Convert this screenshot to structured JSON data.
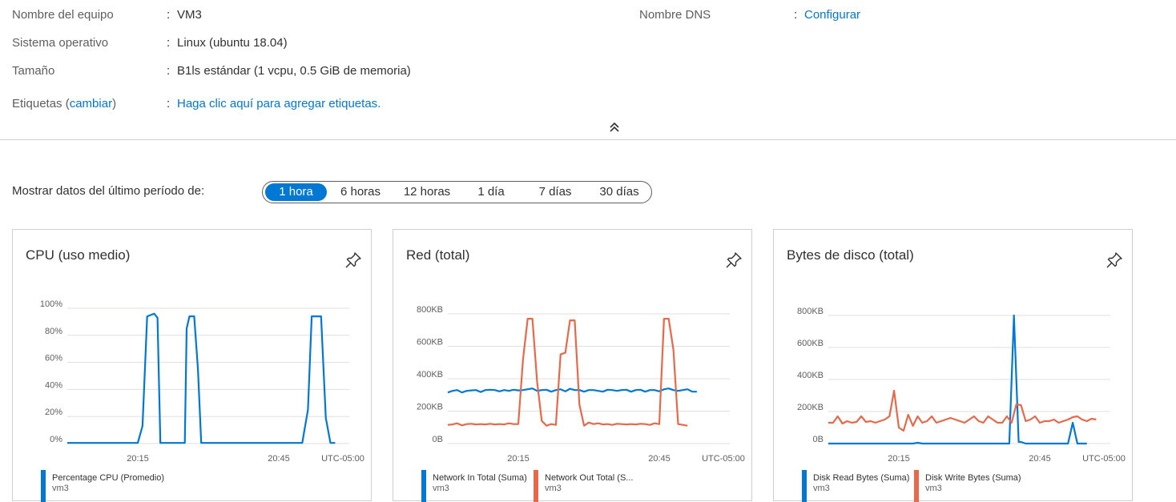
{
  "properties": [
    {
      "label": "Nombre del equipo",
      "colon": ":",
      "value": "VM3"
    },
    {
      "label": "Sistema operativo",
      "colon": ":",
      "value": "Linux (ubuntu 18.04)"
    },
    {
      "label": "Tamaño",
      "colon": ":",
      "value": "B1ls estándar (1 vcpu, 0.5 GiB de memoria)"
    }
  ],
  "tags": {
    "label_prefix": "Etiquetas (",
    "label_link": "cambiar",
    "label_suffix": ")",
    "colon": ":",
    "value_link": "Haga clic aquí para agregar etiquetas."
  },
  "dns": {
    "label": "Nombre DNS",
    "colon": ":",
    "value_link": "Configurar"
  },
  "collapse": {
    "icon": "chevron-double-up-icon"
  },
  "period": {
    "label": "Mostrar datos del último período de:",
    "options": [
      "1 hora",
      "6 horas",
      "12 horas",
      "1 día",
      "7 días",
      "30 días"
    ],
    "selected": "1 hora"
  },
  "colors": {
    "accent": "#0078d4",
    "series_blue": "#0078d4",
    "series_orange": "#e8684a",
    "grid": "#e1dfdd"
  },
  "charts": {
    "cpu": {
      "title": "CPU (uso medio)",
      "legend": [
        {
          "text": "Percentage CPU (Promedio)",
          "sub": "vm3",
          "color": "#0078d4"
        }
      ]
    },
    "net": {
      "title": "Red (total)",
      "legend": [
        {
          "text": "Network In Total (Suma)",
          "sub": "vm3",
          "color": "#0078d4"
        },
        {
          "text": "Network Out Total (S...",
          "sub": "vm3",
          "color": "#e8684a"
        }
      ]
    },
    "disk": {
      "title": "Bytes de disco (total)",
      "legend": [
        {
          "text": "Disk Read Bytes (Suma)",
          "sub": "vm3",
          "color": "#0078d4"
        },
        {
          "text": "Disk Write Bytes (Suma)",
          "sub": "vm3",
          "color": "#e8684a"
        }
      ]
    }
  },
  "chart_data": [
    {
      "type": "line",
      "title": "CPU (uso medio)",
      "x_ticks": [
        "20:15",
        "20:45",
        "UTC-05:00"
      ],
      "y_ticks": [
        "0%",
        "20%",
        "40%",
        "60%",
        "80%",
        "100%"
      ],
      "ylim": [
        0,
        100
      ],
      "x_minutes": [
        0,
        60
      ],
      "grid": true,
      "legend_placement": "bottom",
      "series": [
        {
          "name": "Percentage CPU (Promedio)",
          "color": "#0078d4",
          "points": [
            [
              0,
              0.5
            ],
            [
              1,
              0.5
            ],
            [
              2,
              0.5
            ],
            [
              4,
              0.5
            ],
            [
              6,
              0.5
            ],
            [
              8,
              0.5
            ],
            [
              10,
              0.5
            ],
            [
              12,
              0.5
            ],
            [
              14,
              0.5
            ],
            [
              15,
              0.5
            ],
            [
              16,
              13
            ],
            [
              17,
              94
            ],
            [
              18.5,
              96
            ],
            [
              19.2,
              93
            ],
            [
              19.8,
              0.5
            ],
            [
              21,
              0.5
            ],
            [
              23,
              0.5
            ],
            [
              25,
              0.5
            ],
            [
              25.4,
              85
            ],
            [
              26,
              94
            ],
            [
              27,
              94
            ],
            [
              27.8,
              55
            ],
            [
              28.5,
              0.5
            ],
            [
              30,
              0.5
            ],
            [
              34,
              0.5
            ],
            [
              38,
              0.5
            ],
            [
              42,
              0.5
            ],
            [
              46,
              0.5
            ],
            [
              50,
              0.5
            ],
            [
              51.2,
              25
            ],
            [
              52,
              94
            ],
            [
              54,
              94
            ],
            [
              55,
              19
            ],
            [
              56,
              0.5
            ],
            [
              57,
              0.5
            ]
          ]
        }
      ]
    },
    {
      "type": "line",
      "title": "Red (total)",
      "x_ticks": [
        "20:15",
        "20:45",
        "UTC-05:00"
      ],
      "y_ticks": [
        "0B",
        "200KB",
        "400KB",
        "600KB",
        "800KB"
      ],
      "ylim": [
        0,
        800
      ],
      "x_minutes": [
        0,
        60
      ],
      "grid": true,
      "legend_placement": "bottom",
      "series": [
        {
          "name": "Network In Total (Suma)",
          "color": "#0078d4",
          "points": [
            [
              0,
              315
            ],
            [
              1,
              325
            ],
            [
              2,
              330
            ],
            [
              3,
              315
            ],
            [
              4,
              325
            ],
            [
              5,
              328
            ],
            [
              6,
              330
            ],
            [
              7,
              318
            ],
            [
              8,
              330
            ],
            [
              9,
              332
            ],
            [
              10,
              330
            ],
            [
              11,
              322
            ],
            [
              12,
              330
            ],
            [
              13,
              325
            ],
            [
              14,
              332
            ],
            [
              15,
              328
            ],
            [
              16,
              330
            ],
            [
              17,
              335
            ],
            [
              18,
              340
            ],
            [
              19,
              325
            ],
            [
              20,
              330
            ],
            [
              21,
              332
            ],
            [
              22,
              320
            ],
            [
              23,
              330
            ],
            [
              24,
              335
            ],
            [
              25,
              322
            ],
            [
              26,
              338
            ],
            [
              27,
              330
            ],
            [
              28,
              330
            ],
            [
              29,
              320
            ],
            [
              30,
              330
            ],
            [
              31,
              330
            ],
            [
              32,
              325
            ],
            [
              33,
              320
            ],
            [
              34,
              332
            ],
            [
              35,
              330
            ],
            [
              36,
              325
            ],
            [
              37,
              330
            ],
            [
              38,
              332
            ],
            [
              39,
              320
            ],
            [
              40,
              330
            ],
            [
              41,
              332
            ],
            [
              42,
              320
            ],
            [
              43,
              330
            ],
            [
              44,
              330
            ],
            [
              45,
              322
            ],
            [
              46,
              335
            ],
            [
              47,
              340
            ],
            [
              48,
              330
            ],
            [
              49,
              325
            ],
            [
              50,
              330
            ],
            [
              51,
              335
            ],
            [
              52,
              320
            ],
            [
              53,
              320
            ]
          ]
        },
        {
          "name": "Network Out Total (S...",
          "color": "#e8684a",
          "points": [
            [
              0,
              115
            ],
            [
              1,
              118
            ],
            [
              2,
              125
            ],
            [
              3,
              112
            ],
            [
              4,
              120
            ],
            [
              5,
              122
            ],
            [
              6,
              118
            ],
            [
              7,
              120
            ],
            [
              8,
              118
            ],
            [
              9,
              122
            ],
            [
              10,
              118
            ],
            [
              11,
              120
            ],
            [
              12,
              118
            ],
            [
              13,
              125
            ],
            [
              14,
              120
            ],
            [
              15,
              120
            ],
            [
              16,
              520
            ],
            [
              17,
              770
            ],
            [
              18,
              770
            ],
            [
              19,
              380
            ],
            [
              20,
              140
            ],
            [
              21,
              110
            ],
            [
              22,
              120
            ],
            [
              23,
              115
            ],
            [
              24,
              550
            ],
            [
              25,
              560
            ],
            [
              26,
              760
            ],
            [
              27,
              760
            ],
            [
              28,
              240
            ],
            [
              29,
              110
            ],
            [
              30,
              130
            ],
            [
              31,
              120
            ],
            [
              32,
              125
            ],
            [
              33,
              118
            ],
            [
              34,
              120
            ],
            [
              35,
              115
            ],
            [
              36,
              122
            ],
            [
              37,
              120
            ],
            [
              38,
              118
            ],
            [
              39,
              120
            ],
            [
              40,
              118
            ],
            [
              41,
              122
            ],
            [
              42,
              120
            ],
            [
              43,
              115
            ],
            [
              44,
              125
            ],
            [
              45,
              120
            ],
            [
              46,
              770
            ],
            [
              47,
              770
            ],
            [
              48,
              580
            ],
            [
              49,
              120
            ],
            [
              50,
              115
            ],
            [
              51,
              110
            ]
          ]
        }
      ]
    },
    {
      "type": "line",
      "title": "Bytes de disco (total)",
      "x_ticks": [
        "20:15",
        "20:45",
        "UTC-05:00"
      ],
      "y_ticks": [
        "0B",
        "200KB",
        "400KB",
        "600KB",
        "800KB"
      ],
      "ylim": [
        0,
        800
      ],
      "x_minutes": [
        0,
        60
      ],
      "grid": true,
      "legend_placement": "bottom",
      "series": [
        {
          "name": "Disk Read Bytes (Suma)",
          "color": "#0078d4",
          "points": [
            [
              0,
              0
            ],
            [
              2,
              0
            ],
            [
              4,
              0
            ],
            [
              6,
              0
            ],
            [
              8,
              0
            ],
            [
              10,
              0
            ],
            [
              12,
              0
            ],
            [
              14,
              0
            ],
            [
              18,
              0
            ],
            [
              19,
              5
            ],
            [
              20,
              0
            ],
            [
              24,
              0
            ],
            [
              28,
              0
            ],
            [
              32,
              0
            ],
            [
              36,
              0
            ],
            [
              38.5,
              0
            ],
            [
              39.5,
              800
            ],
            [
              40.5,
              10
            ],
            [
              41,
              10
            ],
            [
              42,
              0
            ],
            [
              46,
              0
            ],
            [
              51,
              0
            ],
            [
              52,
              130
            ],
            [
              53,
              0
            ],
            [
              55,
              0
            ]
          ]
        },
        {
          "name": "Disk Write Bytes (Suma)",
          "color": "#e8684a",
          "points": [
            [
              0,
              130
            ],
            [
              1,
              130
            ],
            [
              2,
              170
            ],
            [
              3,
              125
            ],
            [
              4,
              140
            ],
            [
              5,
              130
            ],
            [
              6,
              135
            ],
            [
              7,
              170
            ],
            [
              8,
              135
            ],
            [
              9,
              140
            ],
            [
              10,
              130
            ],
            [
              11,
              140
            ],
            [
              12,
              150
            ],
            [
              13,
              170
            ],
            [
              14,
              330
            ],
            [
              15,
              100
            ],
            [
              16,
              80
            ],
            [
              17,
              180
            ],
            [
              18,
              110
            ],
            [
              19,
              170
            ],
            [
              20,
              130
            ],
            [
              21,
              140
            ],
            [
              22,
              170
            ],
            [
              23,
              130
            ],
            [
              24,
              140
            ],
            [
              25,
              150
            ],
            [
              26,
              160
            ],
            [
              27,
              150
            ],
            [
              28,
              140
            ],
            [
              29,
              130
            ],
            [
              30,
              150
            ],
            [
              31,
              170
            ],
            [
              32,
              140
            ],
            [
              33,
              130
            ],
            [
              34,
              170
            ],
            [
              35,
              150
            ],
            [
              36,
              130
            ],
            [
              37,
              130
            ],
            [
              38,
              170
            ],
            [
              39,
              130
            ],
            [
              40,
              245
            ],
            [
              41,
              240
            ],
            [
              42,
              140
            ],
            [
              43,
              150
            ],
            [
              44,
              170
            ],
            [
              45,
              130
            ],
            [
              46,
              140
            ],
            [
              47,
              140
            ],
            [
              48,
              150
            ],
            [
              49,
              130
            ],
            [
              50,
              140
            ],
            [
              51,
              150
            ],
            [
              52,
              165
            ],
            [
              53,
              170
            ],
            [
              54,
              150
            ],
            [
              55,
              140
            ],
            [
              56,
              155
            ],
            [
              57,
              150
            ]
          ]
        }
      ]
    }
  ]
}
